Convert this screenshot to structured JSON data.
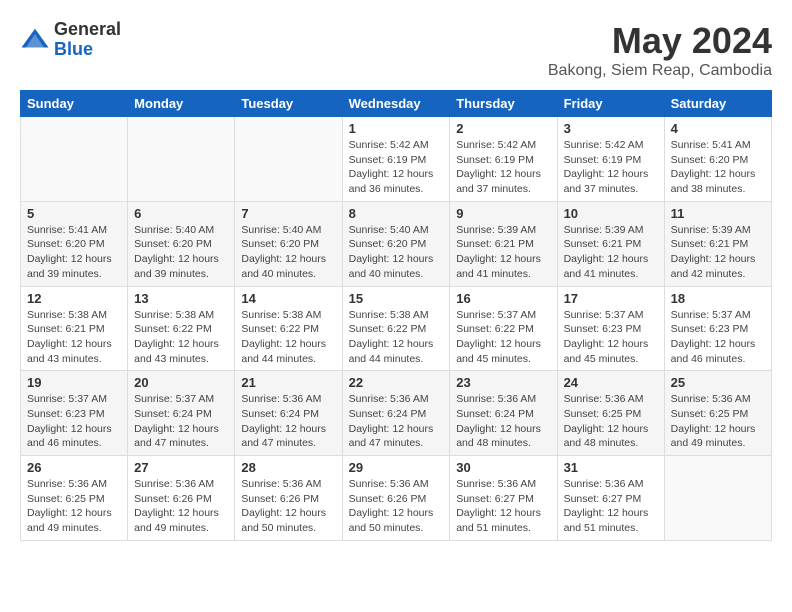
{
  "logo": {
    "general": "General",
    "blue": "Blue"
  },
  "title": {
    "month": "May 2024",
    "location": "Bakong, Siem Reap, Cambodia"
  },
  "headers": [
    "Sunday",
    "Monday",
    "Tuesday",
    "Wednesday",
    "Thursday",
    "Friday",
    "Saturday"
  ],
  "weeks": [
    [
      {
        "day": "",
        "info": ""
      },
      {
        "day": "",
        "info": ""
      },
      {
        "day": "",
        "info": ""
      },
      {
        "day": "1",
        "info": "Sunrise: 5:42 AM\nSunset: 6:19 PM\nDaylight: 12 hours\nand 36 minutes."
      },
      {
        "day": "2",
        "info": "Sunrise: 5:42 AM\nSunset: 6:19 PM\nDaylight: 12 hours\nand 37 minutes."
      },
      {
        "day": "3",
        "info": "Sunrise: 5:42 AM\nSunset: 6:19 PM\nDaylight: 12 hours\nand 37 minutes."
      },
      {
        "day": "4",
        "info": "Sunrise: 5:41 AM\nSunset: 6:20 PM\nDaylight: 12 hours\nand 38 minutes."
      }
    ],
    [
      {
        "day": "5",
        "info": "Sunrise: 5:41 AM\nSunset: 6:20 PM\nDaylight: 12 hours\nand 39 minutes."
      },
      {
        "day": "6",
        "info": "Sunrise: 5:40 AM\nSunset: 6:20 PM\nDaylight: 12 hours\nand 39 minutes."
      },
      {
        "day": "7",
        "info": "Sunrise: 5:40 AM\nSunset: 6:20 PM\nDaylight: 12 hours\nand 40 minutes."
      },
      {
        "day": "8",
        "info": "Sunrise: 5:40 AM\nSunset: 6:20 PM\nDaylight: 12 hours\nand 40 minutes."
      },
      {
        "day": "9",
        "info": "Sunrise: 5:39 AM\nSunset: 6:21 PM\nDaylight: 12 hours\nand 41 minutes."
      },
      {
        "day": "10",
        "info": "Sunrise: 5:39 AM\nSunset: 6:21 PM\nDaylight: 12 hours\nand 41 minutes."
      },
      {
        "day": "11",
        "info": "Sunrise: 5:39 AM\nSunset: 6:21 PM\nDaylight: 12 hours\nand 42 minutes."
      }
    ],
    [
      {
        "day": "12",
        "info": "Sunrise: 5:38 AM\nSunset: 6:21 PM\nDaylight: 12 hours\nand 43 minutes."
      },
      {
        "day": "13",
        "info": "Sunrise: 5:38 AM\nSunset: 6:22 PM\nDaylight: 12 hours\nand 43 minutes."
      },
      {
        "day": "14",
        "info": "Sunrise: 5:38 AM\nSunset: 6:22 PM\nDaylight: 12 hours\nand 44 minutes."
      },
      {
        "day": "15",
        "info": "Sunrise: 5:38 AM\nSunset: 6:22 PM\nDaylight: 12 hours\nand 44 minutes."
      },
      {
        "day": "16",
        "info": "Sunrise: 5:37 AM\nSunset: 6:22 PM\nDaylight: 12 hours\nand 45 minutes."
      },
      {
        "day": "17",
        "info": "Sunrise: 5:37 AM\nSunset: 6:23 PM\nDaylight: 12 hours\nand 45 minutes."
      },
      {
        "day": "18",
        "info": "Sunrise: 5:37 AM\nSunset: 6:23 PM\nDaylight: 12 hours\nand 46 minutes."
      }
    ],
    [
      {
        "day": "19",
        "info": "Sunrise: 5:37 AM\nSunset: 6:23 PM\nDaylight: 12 hours\nand 46 minutes."
      },
      {
        "day": "20",
        "info": "Sunrise: 5:37 AM\nSunset: 6:24 PM\nDaylight: 12 hours\nand 47 minutes."
      },
      {
        "day": "21",
        "info": "Sunrise: 5:36 AM\nSunset: 6:24 PM\nDaylight: 12 hours\nand 47 minutes."
      },
      {
        "day": "22",
        "info": "Sunrise: 5:36 AM\nSunset: 6:24 PM\nDaylight: 12 hours\nand 47 minutes."
      },
      {
        "day": "23",
        "info": "Sunrise: 5:36 AM\nSunset: 6:24 PM\nDaylight: 12 hours\nand 48 minutes."
      },
      {
        "day": "24",
        "info": "Sunrise: 5:36 AM\nSunset: 6:25 PM\nDaylight: 12 hours\nand 48 minutes."
      },
      {
        "day": "25",
        "info": "Sunrise: 5:36 AM\nSunset: 6:25 PM\nDaylight: 12 hours\nand 49 minutes."
      }
    ],
    [
      {
        "day": "26",
        "info": "Sunrise: 5:36 AM\nSunset: 6:25 PM\nDaylight: 12 hours\nand 49 minutes."
      },
      {
        "day": "27",
        "info": "Sunrise: 5:36 AM\nSunset: 6:26 PM\nDaylight: 12 hours\nand 49 minutes."
      },
      {
        "day": "28",
        "info": "Sunrise: 5:36 AM\nSunset: 6:26 PM\nDaylight: 12 hours\nand 50 minutes."
      },
      {
        "day": "29",
        "info": "Sunrise: 5:36 AM\nSunset: 6:26 PM\nDaylight: 12 hours\nand 50 minutes."
      },
      {
        "day": "30",
        "info": "Sunrise: 5:36 AM\nSunset: 6:27 PM\nDaylight: 12 hours\nand 51 minutes."
      },
      {
        "day": "31",
        "info": "Sunrise: 5:36 AM\nSunset: 6:27 PM\nDaylight: 12 hours\nand 51 minutes."
      },
      {
        "day": "",
        "info": ""
      }
    ]
  ]
}
